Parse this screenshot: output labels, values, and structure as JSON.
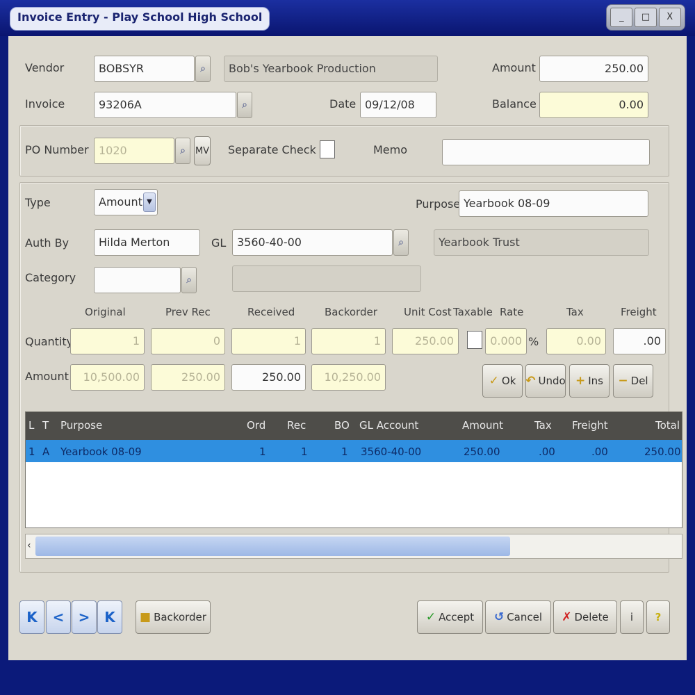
{
  "window": {
    "title": "Invoice Entry - Play School High School",
    "buttons": [
      "_",
      "□",
      "X"
    ]
  },
  "header": {
    "vendor_label": "Vendor",
    "vendor_value": "BOBSYR",
    "vendor_name": "Bob's Yearbook Production",
    "amount_label": "Amount",
    "amount_value": "250.00",
    "invoice_label": "Invoice",
    "invoice_value": "93206A",
    "date_label": "Date",
    "date_value": "09/12/08",
    "balance_label": "Balance",
    "balance_value": "0.00"
  },
  "po": {
    "po_label": "PO Number",
    "po_value": "1020",
    "mv_label": "MV",
    "separate_check_label": "Separate Check",
    "memo_label": "Memo",
    "memo_value": ""
  },
  "detail": {
    "type_label": "Type",
    "type_value": "Amount",
    "purpose_label": "Purpose",
    "purpose_value": "Yearbook 08-09",
    "auth_label": "Auth By",
    "auth_value": "Hilda Merton",
    "gl_label": "GL",
    "gl_value": "3560-40-00",
    "gl_desc": "Yearbook Trust",
    "category_label": "Category",
    "category_value": "",
    "category_desc": ""
  },
  "columns": {
    "original": "Original",
    "prev_rec": "Prev Rec",
    "received": "Received",
    "backorder": "Backorder",
    "unit_cost": "Unit Cost",
    "taxable": "Taxable",
    "rate": "Rate",
    "tax": "Tax",
    "freight": "Freight"
  },
  "quantity_row": {
    "label": "Quantity",
    "original": "1",
    "prev_rec": "0",
    "received": "1",
    "backorder": "1",
    "unit_cost": "250.00",
    "rate": "0.000",
    "rate_unit": "%",
    "tax": "0.00",
    "freight": ".00"
  },
  "amount_row": {
    "label": "Amount",
    "original": "10,500.00",
    "prev_rec": "250.00",
    "received": "250.00",
    "backorder": "10,250.00"
  },
  "actions": {
    "ok": "Ok",
    "undo": "Undo",
    "ins": "Ins",
    "del": "Del"
  },
  "grid": {
    "headers": [
      "L",
      "T",
      "Purpose",
      "Ord",
      "Rec",
      "BO",
      "GL Account",
      "Amount",
      "Tax",
      "Freight",
      "Total"
    ],
    "rows": [
      {
        "l": "1",
        "t": "A",
        "purpose": "Yearbook 08-09",
        "ord": "1",
        "rec": "1",
        "bo": "1",
        "gl": "3560-40-00",
        "amount": "250.00",
        "tax": ".00",
        "freight": ".00",
        "total": "250.00"
      }
    ]
  },
  "footer": {
    "nav": [
      "K",
      "<",
      ">",
      "K"
    ],
    "backorder": "Backorder",
    "accept": "Accept",
    "cancel": "Cancel",
    "delete": "Delete",
    "info": "i",
    "help": "?"
  }
}
